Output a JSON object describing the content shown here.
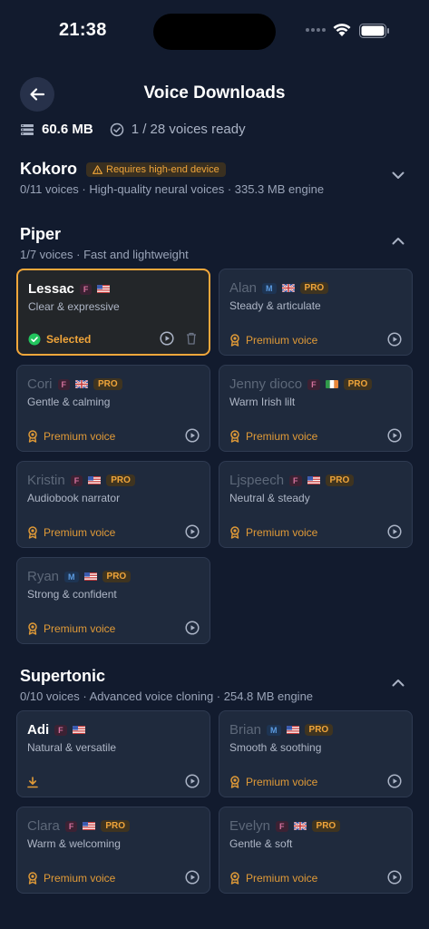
{
  "status_bar": {
    "time": "21:38"
  },
  "header": {
    "title": "Voice Downloads"
  },
  "summary": {
    "storage": "60.6 MB",
    "ready": "1 / 28 voices ready"
  },
  "sections": [
    {
      "id": "kokoro",
      "title": "Kokoro",
      "badge": "Requires high-end device",
      "subtitle": "0/11 voices · High-quality neural voices · 335.3 MB engine",
      "expanded": false
    },
    {
      "id": "piper",
      "title": "Piper",
      "subtitle": "1/7 voices · Fast and lightweight",
      "expanded": true
    },
    {
      "id": "supertonic",
      "title": "Supertonic",
      "subtitle": "0/10 voices · Advanced voice cloning · 254.8 MB engine",
      "expanded": true
    }
  ],
  "piper_voices": [
    {
      "name": "Lessac",
      "gender": "F",
      "flag": "us",
      "desc": "Clear & expressive",
      "status": "Selected",
      "pro": ""
    },
    {
      "name": "Alan",
      "gender": "M",
      "flag": "gb",
      "desc": "Steady & articulate",
      "status": "Premium voice",
      "pro": "PRO"
    },
    {
      "name": "Cori",
      "gender": "F",
      "flag": "gb",
      "desc": "Gentle & calming",
      "status": "Premium voice",
      "pro": "PRO"
    },
    {
      "name": "Jenny dioco",
      "gender": "F",
      "flag": "ie",
      "desc": "Warm Irish lilt",
      "status": "Premium voice",
      "pro": "PRO"
    },
    {
      "name": "Kristin",
      "gender": "F",
      "flag": "us",
      "desc": "Audiobook narrator",
      "status": "Premium voice",
      "pro": "PRO"
    },
    {
      "name": "Ljspeech",
      "gender": "F",
      "flag": "us",
      "desc": "Neutral & steady",
      "status": "Premium voice",
      "pro": "PRO"
    },
    {
      "name": "Ryan",
      "gender": "M",
      "flag": "us",
      "desc": "Strong & confident",
      "status": "Premium voice",
      "pro": "PRO"
    }
  ],
  "supertonic_voices": [
    {
      "name": "Adi",
      "gender": "F",
      "flag": "us",
      "desc": "Natural & versatile",
      "status": "",
      "pro": ""
    },
    {
      "name": "Brian",
      "gender": "M",
      "flag": "us",
      "desc": "Smooth & soothing",
      "status": "Premium voice",
      "pro": "PRO"
    },
    {
      "name": "Clara",
      "gender": "F",
      "flag": "us",
      "desc": "Warm & welcoming",
      "status": "Premium voice",
      "pro": "PRO"
    },
    {
      "name": "Evelyn",
      "gender": "F",
      "flag": "gb",
      "desc": "Gentle & soft",
      "status": "Premium voice",
      "pro": "PRO"
    }
  ],
  "colors": {
    "accent": "#f0a53a",
    "selected_check": "#22c55e",
    "background": "#121b2e",
    "card": "#1f2a3d"
  },
  "icons": {
    "back": "arrow-left-icon",
    "storage": "storage-icon",
    "ready": "check-circle-icon",
    "warning": "warning-icon",
    "premium": "award-icon",
    "play": "play-icon",
    "delete": "trash-icon",
    "download": "download-icon"
  }
}
